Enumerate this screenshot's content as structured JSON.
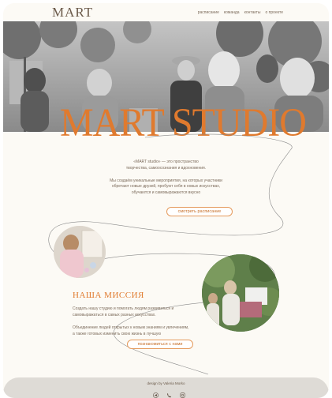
{
  "nav": {
    "logo": "MART",
    "items": [
      "расписание",
      "команда",
      "контакты",
      "о проекте"
    ]
  },
  "hero": {
    "title": "MART STUDIO"
  },
  "intro": {
    "paragraph1": "«MART studio» — это пространство творчества, самоосознания и вдохновения.",
    "paragraph2": "Мы создаём уникальные мероприятия, на которых участники обретают новые друзей, пробуют себя в новых искусствах, обучаются и самовыражаются вкусно",
    "button": "смотреть расписание"
  },
  "mission": {
    "title": "НАША МИССИЯ",
    "paragraph1": "Создать нашу студию и помогать людям развиваться и самовыражаться в самых разных искусствах.",
    "paragraph2": "Объединение людей открытых к новым знаниям и увлечениям, а также готовых изменить свою жизнь в лучшую",
    "button": "познакомиться с нами"
  },
  "footer": {
    "credit": "design by Valeria Morko",
    "icons": [
      "telegram-icon",
      "phone-icon",
      "instagram-icon"
    ]
  },
  "colors": {
    "accent": "#e07a2e",
    "background": "#fcfaf5",
    "footer": "#dedbd6"
  }
}
